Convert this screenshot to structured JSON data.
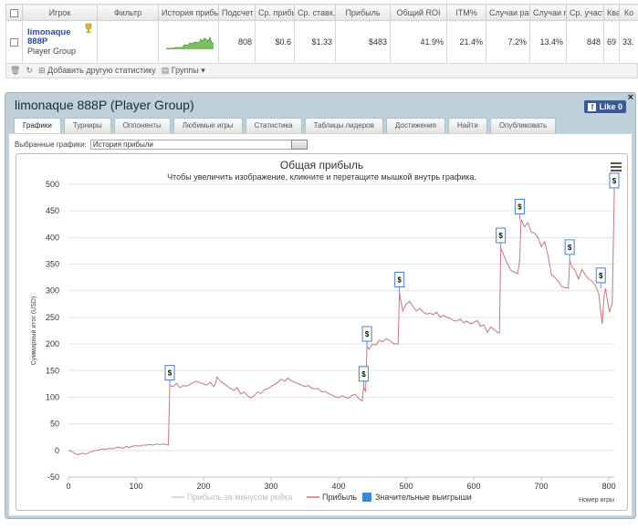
{
  "stats_table": {
    "columns": [
      "",
      "Игрок",
      "Фильтр",
      "История прибы",
      "Подсчет",
      "Ср. прибы",
      "Ср. ставк.",
      "Прибыль",
      "Общий ROI",
      "ITM%",
      "Случаи ра",
      "Случаи п",
      "Ср. участ",
      "Квалі",
      "Ко"
    ],
    "row": {
      "player_name": "limonaque 888P",
      "player_group": "Player Group",
      "filter": "",
      "count": "808",
      "avg_profit": "$0.6",
      "avg_stake": "$1.33",
      "profit": "$483",
      "total_roi": "41.9%",
      "itm": "21.4%",
      "cases1": "7.2%",
      "cases2": "13.4%",
      "avg_part": "848",
      "qual": "69",
      "ko": "33."
    },
    "toolbar": {
      "add_stat": "Добавить другую статистику",
      "groups": "Группы"
    }
  },
  "panel": {
    "title": "limonaque 888P (Player Group)",
    "like_label": "Like 0",
    "close": "×",
    "tabs": [
      "Графики",
      "Турниры",
      "Оппоненты",
      "Любимые игры",
      "Статистика",
      "Таблицы лидеров",
      "Достижения",
      "Найти",
      "Опубликовать"
    ],
    "active_tab": 0,
    "graph_select_label": "Выбранные графики:",
    "graph_select_value": "История прибыли"
  },
  "colors": {
    "profit_line": "#c4797c",
    "rake_line": "#cccccc",
    "big_win": "#3b88d6",
    "flag_border": "#4a7fc0"
  },
  "chart_data": {
    "type": "line",
    "title": "Общая прибыль",
    "subtitle": "Чтобы увеличить изображение, кликните и перетащите мышкой внутрь графика.",
    "xlabel": "Номер игры",
    "ylabel": "Суммарный итог (USD)",
    "xlim": [
      0,
      808
    ],
    "ylim": [
      -50,
      500
    ],
    "x_ticks": [
      "0",
      "100",
      "200",
      "300",
      "400",
      "500",
      "600",
      "700",
      "800"
    ],
    "y_ticks": [
      "-50",
      "0",
      "50",
      "100",
      "150",
      "200",
      "250",
      "300",
      "350",
      "400",
      "450",
      "500"
    ],
    "grid": true,
    "legend_position": "bottom",
    "legend": [
      "Прибыль за минусом рейка",
      "Прибыль",
      "Значительные выигрыши"
    ],
    "series": [
      {
        "name": "Прибыль",
        "points": [
          [
            0,
            0
          ],
          [
            5,
            -2
          ],
          [
            10,
            -6
          ],
          [
            15,
            -8
          ],
          [
            20,
            -5
          ],
          [
            25,
            -7
          ],
          [
            30,
            -4
          ],
          [
            35,
            -2
          ],
          [
            40,
            0
          ],
          [
            45,
            1
          ],
          [
            50,
            3
          ],
          [
            55,
            2
          ],
          [
            60,
            4
          ],
          [
            65,
            3
          ],
          [
            70,
            5
          ],
          [
            75,
            6
          ],
          [
            80,
            4
          ],
          [
            85,
            7
          ],
          [
            90,
            6
          ],
          [
            95,
            8
          ],
          [
            100,
            9
          ],
          [
            105,
            8
          ],
          [
            110,
            10
          ],
          [
            115,
            10
          ],
          [
            120,
            11
          ],
          [
            125,
            10
          ],
          [
            130,
            12
          ],
          [
            135,
            11
          ],
          [
            140,
            12
          ],
          [
            145,
            11
          ],
          [
            148,
            10
          ],
          [
            150,
            122
          ],
          [
            155,
            120
          ],
          [
            160,
            126
          ],
          [
            165,
            118
          ],
          [
            170,
            122
          ],
          [
            175,
            121
          ],
          [
            180,
            124
          ],
          [
            185,
            128
          ],
          [
            190,
            130
          ],
          [
            195,
            127
          ],
          [
            200,
            125
          ],
          [
            205,
            123
          ],
          [
            210,
            128
          ],
          [
            215,
            120
          ],
          [
            218,
            126
          ],
          [
            220,
            138
          ],
          [
            225,
            130
          ],
          [
            230,
            126
          ],
          [
            235,
            121
          ],
          [
            240,
            116
          ],
          [
            245,
            113
          ],
          [
            250,
            118
          ],
          [
            255,
            106
          ],
          [
            260,
            110
          ],
          [
            265,
            103
          ],
          [
            270,
            99
          ],
          [
            275,
            103
          ],
          [
            280,
            110
          ],
          [
            285,
            107
          ],
          [
            290,
            114
          ],
          [
            295,
            116
          ],
          [
            300,
            120
          ],
          [
            305,
            124
          ],
          [
            310,
            128
          ],
          [
            315,
            134
          ],
          [
            320,
            130
          ],
          [
            325,
            136
          ],
          [
            330,
            131
          ],
          [
            335,
            128
          ],
          [
            340,
            126
          ],
          [
            345,
            123
          ],
          [
            350,
            120
          ],
          [
            355,
            122
          ],
          [
            360,
            117
          ],
          [
            365,
            116
          ],
          [
            370,
            116
          ],
          [
            375,
            110
          ],
          [
            380,
            111
          ],
          [
            385,
            107
          ],
          [
            390,
            104
          ],
          [
            395,
            101
          ],
          [
            400,
            99
          ],
          [
            405,
            103
          ],
          [
            410,
            100
          ],
          [
            415,
            98
          ],
          [
            420,
            104
          ],
          [
            425,
            105
          ],
          [
            430,
            97
          ],
          [
            435,
            93
          ],
          [
            437,
            120
          ],
          [
            440,
            110
          ],
          [
            442,
            195
          ],
          [
            445,
            190
          ],
          [
            450,
            200
          ],
          [
            455,
            198
          ],
          [
            460,
            207
          ],
          [
            465,
            204
          ],
          [
            470,
            210
          ],
          [
            475,
            207
          ],
          [
            480,
            202
          ],
          [
            485,
            200
          ],
          [
            488,
            200
          ],
          [
            490,
            297
          ],
          [
            495,
            262
          ],
          [
            500,
            275
          ],
          [
            505,
            280
          ],
          [
            510,
            270
          ],
          [
            515,
            262
          ],
          [
            520,
            267
          ],
          [
            525,
            260
          ],
          [
            530,
            256
          ],
          [
            535,
            258
          ],
          [
            540,
            255
          ],
          [
            545,
            260
          ],
          [
            550,
            250
          ],
          [
            555,
            254
          ],
          [
            560,
            250
          ],
          [
            565,
            248
          ],
          [
            570,
            244
          ],
          [
            575,
            243
          ],
          [
            580,
            247
          ],
          [
            585,
            240
          ],
          [
            590,
            243
          ],
          [
            595,
            238
          ],
          [
            600,
            240
          ],
          [
            605,
            244
          ],
          [
            610,
            233
          ],
          [
            615,
            236
          ],
          [
            620,
            222
          ],
          [
            625,
            232
          ],
          [
            630,
            227
          ],
          [
            635,
            222
          ],
          [
            638,
            221
          ],
          [
            640,
            380
          ],
          [
            645,
            365
          ],
          [
            650,
            350
          ],
          [
            655,
            338
          ],
          [
            660,
            335
          ],
          [
            665,
            332
          ],
          [
            668,
            358
          ],
          [
            670,
            434
          ],
          [
            675,
            420
          ],
          [
            680,
            428
          ],
          [
            685,
            410
          ],
          [
            690,
            408
          ],
          [
            695,
            400
          ],
          [
            700,
            383
          ],
          [
            705,
            392
          ],
          [
            710,
            365
          ],
          [
            715,
            330
          ],
          [
            720,
            325
          ],
          [
            725,
            318
          ],
          [
            730,
            308
          ],
          [
            735,
            306
          ],
          [
            740,
            305
          ],
          [
            742,
            358
          ],
          [
            745,
            345
          ],
          [
            750,
            338
          ],
          [
            755,
            322
          ],
          [
            760,
            340
          ],
          [
            765,
            330
          ],
          [
            770,
            322
          ],
          [
            775,
            318
          ],
          [
            780,
            310
          ],
          [
            785,
            295
          ],
          [
            788,
            260
          ],
          [
            790,
            238
          ],
          [
            793,
            290
          ],
          [
            795,
            305
          ],
          [
            798,
            280
          ],
          [
            801,
            260
          ],
          [
            803,
            270
          ],
          [
            805,
            275
          ],
          [
            808,
            483
          ]
        ]
      },
      {
        "name": "Значительные выигрыши",
        "points": [
          [
            150,
            122
          ],
          [
            437,
            120
          ],
          [
            442,
            195
          ],
          [
            490,
            297
          ],
          [
            640,
            380
          ],
          [
            668,
            434
          ],
          [
            742,
            358
          ],
          [
            788,
            305
          ],
          [
            808,
            483
          ]
        ]
      }
    ]
  }
}
